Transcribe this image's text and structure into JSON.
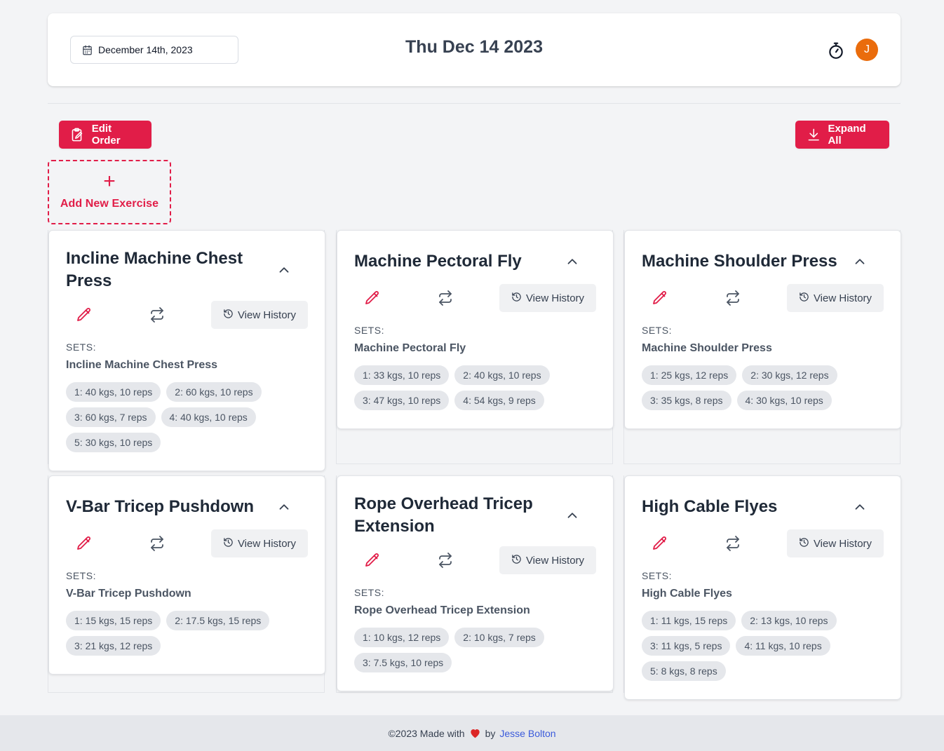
{
  "header": {
    "date_picker": "December 14th, 2023",
    "title": "Thu Dec 14 2023",
    "avatar_initial": "J",
    "accent": "#e11d48",
    "avatar_color": "#ea6c0c"
  },
  "toolbar": {
    "edit_order": "Edit Order",
    "expand_all": "Expand All",
    "add_new_exercise": "Add New Exercise",
    "add_icon": "+"
  },
  "cards": [
    {
      "title": "Incline Machine Chest Press",
      "view_history": "View History",
      "sets_label": "SETS:",
      "exercise_name": "Incline Machine Chest Press",
      "sets": [
        "1: 40 kgs, 10 reps",
        "2: 60 kgs, 10 reps",
        "3: 60 kgs, 7 reps",
        "4: 40 kgs, 10 reps",
        "5: 30 kgs, 10 reps"
      ]
    },
    {
      "title": "Machine Pectoral Fly",
      "view_history": "View History",
      "sets_label": "SETS:",
      "exercise_name": "Machine Pectoral Fly",
      "sets": [
        "1: 33 kgs, 10 reps",
        "2: 40 kgs, 10 reps",
        "3: 47 kgs, 10 reps",
        "4: 54 kgs, 9 reps"
      ]
    },
    {
      "title": "Machine Shoulder Press",
      "view_history": "View History",
      "sets_label": "SETS:",
      "exercise_name": "Machine Shoulder Press",
      "sets": [
        "1: 25 kgs, 12 reps",
        "2: 30 kgs, 12 reps",
        "3: 35 kgs, 8 reps",
        "4: 30 kgs, 10 reps"
      ]
    },
    {
      "title": "V-Bar Tricep Pushdown",
      "view_history": "View History",
      "sets_label": "SETS:",
      "exercise_name": "V-Bar Tricep Pushdown",
      "sets": [
        "1: 15 kgs, 15 reps",
        "2: 17.5 kgs, 15 reps",
        "3: 21 kgs, 12 reps"
      ]
    },
    {
      "title": "Rope Overhead Tricep Extension",
      "view_history": "View History",
      "sets_label": "SETS:",
      "exercise_name": "Rope Overhead Tricep Extension",
      "sets": [
        "1: 10 kgs, 12 reps",
        "2: 10 kgs, 7 reps",
        "3: 7.5 kgs, 10 reps"
      ]
    },
    {
      "title": "High Cable Flyes",
      "view_history": "View History",
      "sets_label": "SETS:",
      "exercise_name": "High Cable Flyes",
      "sets": [
        "1: 11 kgs, 15 reps",
        "2: 13 kgs, 10 reps",
        "3: 11 kgs, 5 reps",
        "4: 11 kgs, 10 reps",
        "5: 8 kgs, 8 reps"
      ]
    }
  ],
  "footer": {
    "prefix": "©2023 Made with",
    "by": "by",
    "author": "Jesse Bolton"
  }
}
